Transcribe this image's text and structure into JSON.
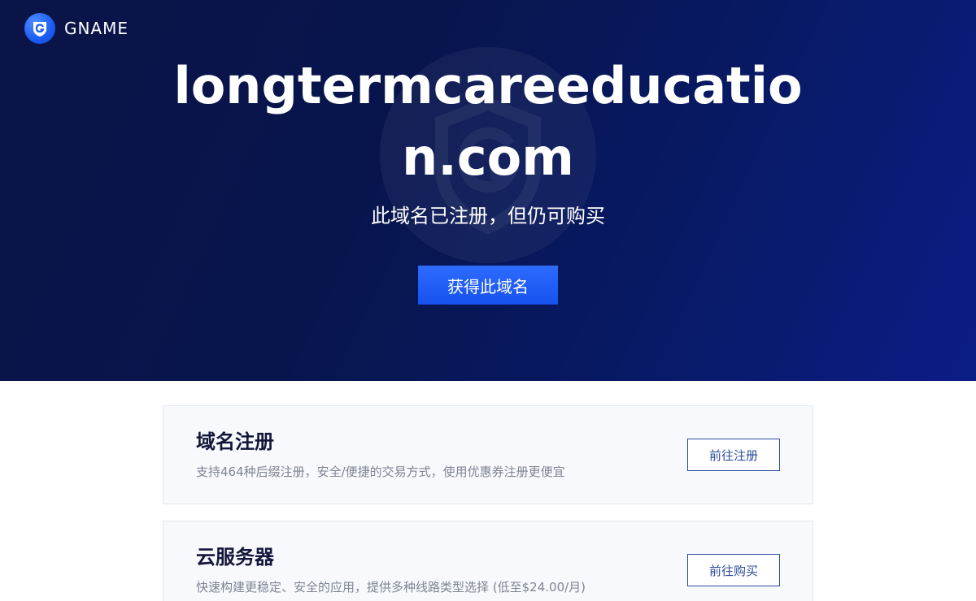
{
  "brand": {
    "name": "GNAME",
    "icon": "gname-logo-icon"
  },
  "hero": {
    "domain": "longtermcareeducation.com",
    "subtitle": "此域名已注册，但仍可购买",
    "cta_label": "获得此域名",
    "watermark_icon": "shield-g-watermark-icon"
  },
  "cards": [
    {
      "title": "域名注册",
      "description": "支持464种后缀注册，安全/便捷的交易方式，使用优惠券注册更便宜",
      "button_label": "前往注册"
    },
    {
      "title": "云服务器",
      "description": "快速构建更稳定、安全的应用，提供多种线路类型选择 (低至$24.00/月)",
      "button_label": "前往购买"
    }
  ],
  "colors": {
    "hero_background": "#08154d",
    "accent_button": "#1652ee",
    "outline_button": "#2b4b9b",
    "card_background": "#f7f9fc"
  }
}
